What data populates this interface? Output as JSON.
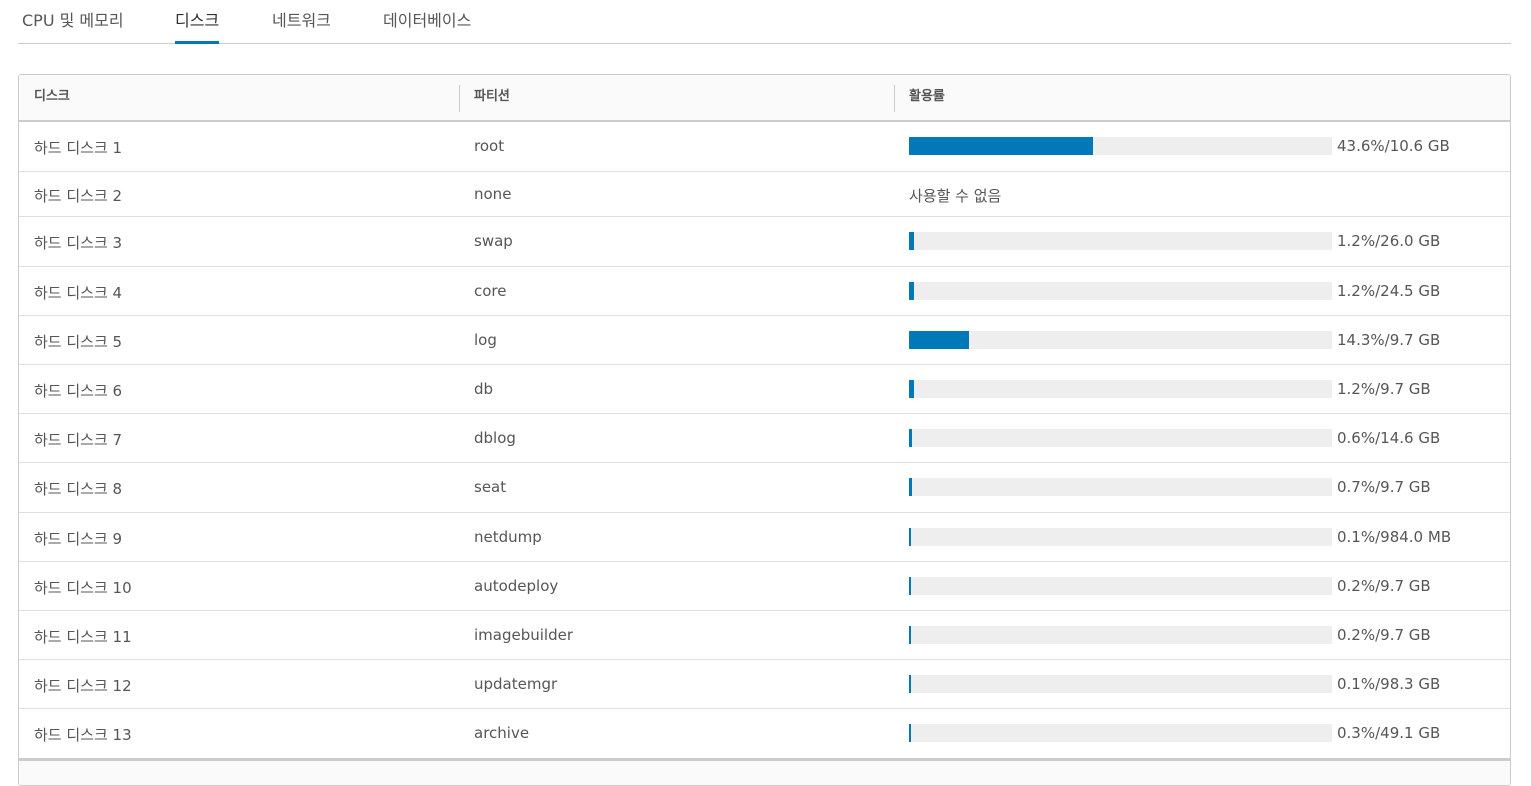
{
  "tabs": [
    {
      "label": "CPU 및 메모리",
      "active": false
    },
    {
      "label": "디스크",
      "active": true
    },
    {
      "label": "네트워크",
      "active": false
    },
    {
      "label": "데이터베이스",
      "active": false
    }
  ],
  "table": {
    "columns": [
      "디스크",
      "파티션",
      "활용률"
    ],
    "rows": [
      {
        "disk": "하드 디스크 1",
        "partition": "root",
        "usage_fraction": 0.436,
        "usage_text": "43.6%/10.6 GB"
      },
      {
        "disk": "하드 디스크 2",
        "partition": "none",
        "usage_fraction": null,
        "usage_text": "사용할 수 없음"
      },
      {
        "disk": "하드 디스크 3",
        "partition": "swap",
        "usage_fraction": 0.012,
        "usage_text": "1.2%/26.0 GB"
      },
      {
        "disk": "하드 디스크 4",
        "partition": "core",
        "usage_fraction": 0.012,
        "usage_text": "1.2%/24.5 GB"
      },
      {
        "disk": "하드 디스크 5",
        "partition": "log",
        "usage_fraction": 0.143,
        "usage_text": "14.3%/9.7 GB"
      },
      {
        "disk": "하드 디스크 6",
        "partition": "db",
        "usage_fraction": 0.012,
        "usage_text": "1.2%/9.7 GB"
      },
      {
        "disk": "하드 디스크 7",
        "partition": "dblog",
        "usage_fraction": 0.006,
        "usage_text": "0.6%/14.6 GB"
      },
      {
        "disk": "하드 디스크 8",
        "partition": "seat",
        "usage_fraction": 0.007,
        "usage_text": "0.7%/9.7 GB"
      },
      {
        "disk": "하드 디스크 9",
        "partition": "netdump",
        "usage_fraction": 0.001,
        "usage_text": "0.1%/984.0 MB"
      },
      {
        "disk": "하드 디스크 10",
        "partition": "autodeploy",
        "usage_fraction": 0.002,
        "usage_text": "0.2%/9.7 GB"
      },
      {
        "disk": "하드 디스크 11",
        "partition": "imagebuilder",
        "usage_fraction": 0.002,
        "usage_text": "0.2%/9.7 GB"
      },
      {
        "disk": "하드 디스크 12",
        "partition": "updatemgr",
        "usage_fraction": 0.001,
        "usage_text": "0.1%/98.3 GB"
      },
      {
        "disk": "하드 디스크 13",
        "partition": "archive",
        "usage_fraction": 0.003,
        "usage_text": "0.3%/49.1 GB"
      }
    ]
  },
  "colors": {
    "accent": "#0079b8",
    "track": "#eeeeee"
  }
}
